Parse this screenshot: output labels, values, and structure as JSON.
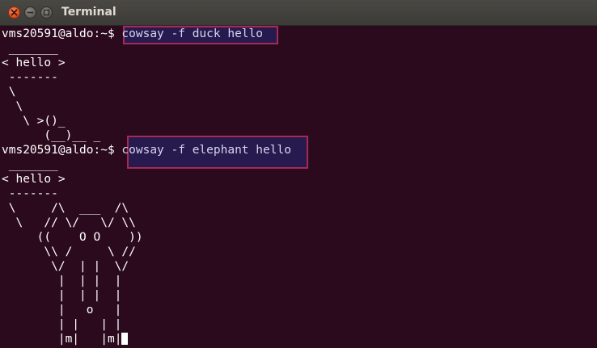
{
  "window": {
    "title": "Terminal",
    "buttons": {
      "close": "close-icon",
      "minimize": "minimize-icon",
      "maximize": "maximize-icon"
    }
  },
  "colors": {
    "terminal_bg": "#2c0a1e",
    "highlight_border": "#a62a55",
    "highlight_fill": "#261a4e",
    "close_button": "#df4b16"
  },
  "terminal": {
    "session1": {
      "prompt": "vms20591@aldo:~$ ",
      "command": "cowsay -f duck hello",
      "output": [
        " _______",
        "< hello >",
        " -------",
        " \\",
        "  \\",
        "   \\ >()_",
        "      (__)__ _"
      ]
    },
    "session2": {
      "prompt": "vms20591@aldo:~$ ",
      "command": "cowsay -f elephant hello",
      "output": [
        " _______",
        "< hello >",
        " -------",
        " \\     /\\  ___  /\\",
        "  \\   // \\/   \\/ \\\\",
        "     ((    O O    ))",
        "      \\\\ /     \\ //",
        "       \\/  | |  \\/",
        "        |  | |  |",
        "        |  | |  |",
        "        |   o   |",
        "        | |   | |",
        "        |m|   |m"
      ],
      "last_line_suffix": "|"
    }
  }
}
